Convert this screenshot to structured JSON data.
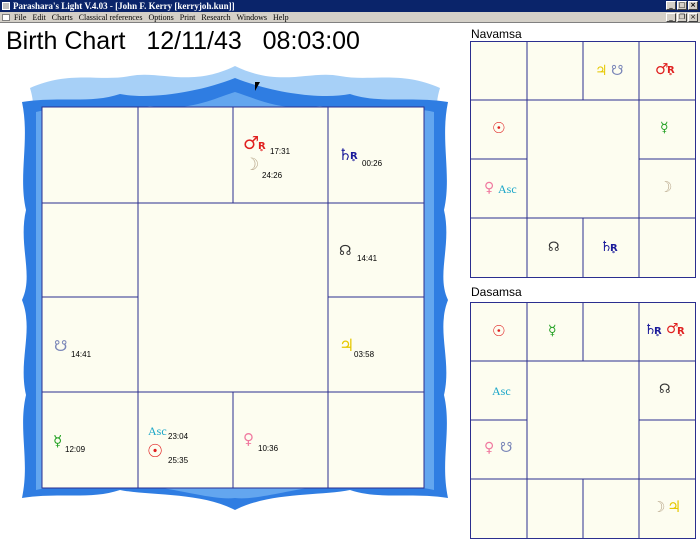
{
  "window": {
    "title": "Parashara's Light V.4.03 - [John F. Kerry [kerryjoh.kun]]"
  },
  "menu": {
    "items": [
      "File",
      "Edit",
      "Charts",
      "Classical references",
      "Options",
      "Print",
      "Research",
      "Windows",
      "Help"
    ]
  },
  "birth_chart": {
    "title": "Birth Chart",
    "date": "12/11/43",
    "time": "08:03:00",
    "colors": {
      "frame_light": "#a7d0f7",
      "frame_dark": "#2f7de2",
      "cell_bg": "#fdfdf0",
      "line": "#2b2f8f"
    },
    "planets": {
      "mars": {
        "glyph": "♂",
        "rx": "R̥",
        "degree": "17:31",
        "color": "#e02020"
      },
      "moon": {
        "glyph": "☽",
        "degree": "24:26",
        "color": "#b9a88c"
      },
      "saturn": {
        "glyph": "♄",
        "rx": "R̥",
        "degree": "00:26",
        "color": "#1a1a9a"
      },
      "rahu": {
        "glyph": "☊",
        "degree": "14:41",
        "color": "#333333"
      },
      "ketu": {
        "glyph": "☋",
        "degree": "14:41",
        "color": "#7a86b8"
      },
      "jupiter": {
        "glyph": "♃",
        "degree": "03:58",
        "color": "#e6c800"
      },
      "mercury": {
        "glyph": "☿",
        "degree": "12:09",
        "color": "#22a022"
      },
      "ascendant": {
        "label": "Asc",
        "degree": "23:04",
        "color": "#1aa6c8"
      },
      "sun": {
        "glyph": "☉",
        "degree": "25:35",
        "color": "#e02020"
      },
      "venus": {
        "glyph": "♀",
        "degree": "10:36",
        "color": "#f07aa0"
      }
    }
  },
  "navamsa": {
    "title": "Navamsa",
    "glyphs": {
      "jupiter": "♃",
      "ketu": "☋",
      "mars": "♂",
      "rx": "R̥",
      "sun": "☉",
      "mercury": "☿",
      "venus": "♀",
      "asc": "Asc",
      "moon": "☽",
      "rahu": "☊",
      "saturn": "♄"
    }
  },
  "dasamsa": {
    "title": "Dasamsa",
    "glyphs": {
      "sun": "☉",
      "mercury": "☿",
      "saturn": "♄",
      "mars": "♂",
      "rx": "R̥",
      "asc": "Asc",
      "rahu": "☊",
      "venus": "♀",
      "ketu": "☋",
      "moon": "☽",
      "jupiter": "♃"
    }
  }
}
